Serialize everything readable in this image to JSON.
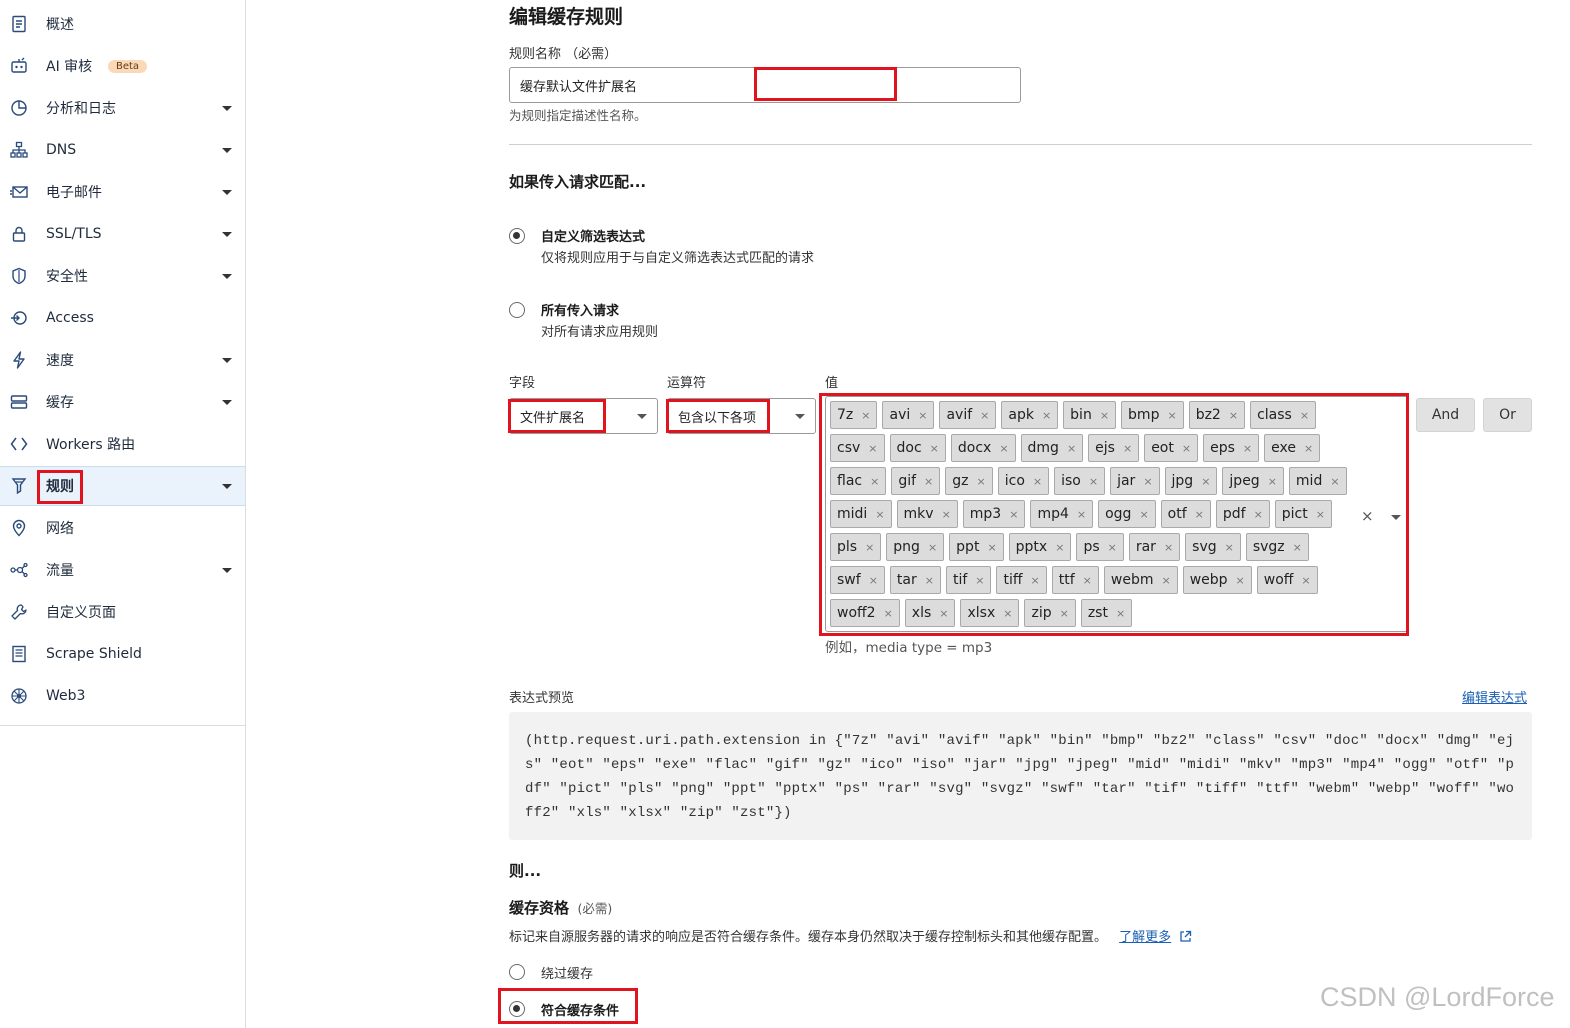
{
  "sidebar": {
    "items": [
      {
        "label": "概述",
        "icon": "document-icon",
        "caret": false
      },
      {
        "label": "AI 审核",
        "icon": "ai-audit-icon",
        "caret": false,
        "badge": "Beta"
      },
      {
        "label": "分析和日志",
        "icon": "pie-chart-icon",
        "caret": true
      },
      {
        "label": "DNS",
        "icon": "network-tree-icon",
        "caret": true
      },
      {
        "label": "电子邮件",
        "icon": "email-icon",
        "caret": true
      },
      {
        "label": "SSL/TLS",
        "icon": "lock-icon",
        "caret": true
      },
      {
        "label": "安全性",
        "icon": "shield-icon",
        "caret": true
      },
      {
        "label": "Access",
        "icon": "access-icon",
        "caret": false
      },
      {
        "label": "速度",
        "icon": "lightning-icon",
        "caret": true
      },
      {
        "label": "缓存",
        "icon": "server-stack-icon",
        "caret": true
      },
      {
        "label": "Workers 路由",
        "icon": "code-brackets-icon",
        "caret": false
      },
      {
        "label": "规则",
        "icon": "rules-funnel-icon",
        "caret": true,
        "active": true
      },
      {
        "label": "网络",
        "icon": "location-pin-icon",
        "caret": false
      },
      {
        "label": "流量",
        "icon": "traffic-icon",
        "caret": true
      },
      {
        "label": "自定义页面",
        "icon": "wrench-icon",
        "caret": false
      },
      {
        "label": "Scrape Shield",
        "icon": "page-list-icon",
        "caret": false
      },
      {
        "label": "Web3",
        "icon": "web3-icon",
        "caret": false
      }
    ]
  },
  "form": {
    "title": "编辑缓存规则",
    "rule_name_label": "规则名称 （必需）",
    "rule_name_value": "缓存默认文件扩展名",
    "rule_name_hint": "为规则指定描述性名称。",
    "match_title": "如果传入请求匹配...",
    "option_custom_title": "自定义筛选表达式",
    "option_custom_desc": "仅将规则应用于与自定义筛选表达式匹配的请求",
    "option_all_title": "所有传入请求",
    "option_all_desc": "对所有请求应用规则",
    "field_label": "字段",
    "field_value": "文件扩展名",
    "operator_label": "运算符",
    "operator_value": "包含以下各项",
    "value_label": "值",
    "tags": [
      "7z",
      "avi",
      "avif",
      "apk",
      "bin",
      "bmp",
      "bz2",
      "class",
      "csv",
      "doc",
      "docx",
      "dmg",
      "ejs",
      "eot",
      "eps",
      "exe",
      "flac",
      "gif",
      "gz",
      "ico",
      "iso",
      "jar",
      "jpg",
      "jpeg",
      "mid",
      "midi",
      "mkv",
      "mp3",
      "mp4",
      "ogg",
      "otf",
      "pdf",
      "pict",
      "pls",
      "png",
      "ppt",
      "pptx",
      "ps",
      "rar",
      "svg",
      "svgz",
      "swf",
      "tar",
      "tif",
      "tiff",
      "ttf",
      "webm",
      "webp",
      "woff",
      "woff2",
      "xls",
      "xlsx",
      "zip",
      "zst"
    ],
    "tag_remove_glyph": "×",
    "clear_glyph": "×",
    "and_label": "And",
    "or_label": "Or",
    "value_example": "例如，media type = mp3",
    "expression_label": "表达式预览",
    "edit_expression_link": "编辑表达式",
    "expression": "(http.request.uri.path.extension in {\"7z\" \"avi\" \"avif\" \"apk\" \"bin\" \"bmp\" \"bz2\" \"class\" \"csv\" \"doc\" \"docx\" \"dmg\" \"ejs\" \"eot\" \"eps\" \"exe\" \"flac\" \"gif\" \"gz\" \"ico\" \"iso\" \"jar\" \"jpg\" \"jpeg\" \"mid\" \"midi\" \"mkv\" \"mp3\" \"mp4\" \"ogg\" \"otf\" \"pdf\" \"pict\" \"pls\" \"png\" \"ppt\" \"pptx\" \"ps\" \"rar\" \"svg\" \"svgz\" \"swf\" \"tar\" \"tif\" \"tiff\" \"ttf\" \"webm\" \"webp\" \"woff\" \"woff2\" \"xls\" \"xlsx\" \"zip\" \"zst\"})",
    "then_title": "则...",
    "eligibility_title": "缓存资格",
    "eligibility_required": "(必需)",
    "eligibility_desc": "标记来自源服务器的请求的响应是否符合缓存条件。缓存本身仍然取决于缓存控制标头和其他缓存配置。",
    "learn_more": "了解更多",
    "bypass_label": "绕过缓存",
    "eligible_label": "符合缓存条件"
  },
  "watermark": "CSDN @LordForce",
  "colors": {
    "highlight": "#e0141e",
    "link": "#1a5fb4",
    "active_bg": "#eaf2fb"
  }
}
